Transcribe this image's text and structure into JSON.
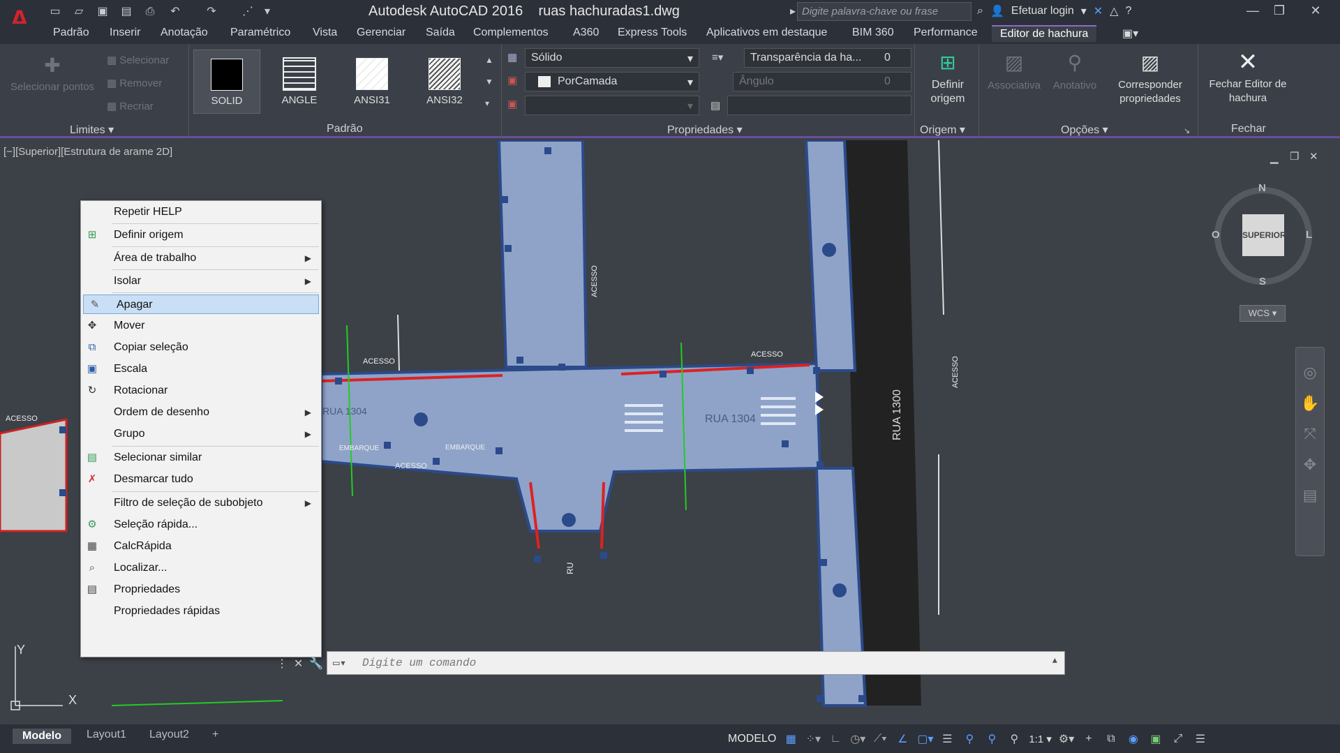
{
  "app": {
    "logo": "A",
    "title": "Autodesk AutoCAD 2016",
    "file": "ruas hachuradas1.dwg"
  },
  "search": {
    "placeholder": "Digite palavra-chave ou frase"
  },
  "account": {
    "login": "Efetuar login"
  },
  "menu_tabs": [
    "Padrão",
    "Inserir",
    "Anotação",
    "Paramétrico",
    "Vista",
    "Gerenciar",
    "Saída",
    "Complementos",
    "A360",
    "Express Tools",
    "Aplicativos em destaque",
    "BIM 360",
    "Performance",
    "Editor de hachura"
  ],
  "ribbon": {
    "limits": {
      "pick": "Selecionar pontos",
      "select": "Selecionar",
      "remove": "Remover",
      "recreate": "Recriar",
      "title": "Limites"
    },
    "patterns": {
      "items": [
        "SOLID",
        "ANGLE",
        "ANSI31",
        "ANSI32"
      ],
      "title": "Padrão"
    },
    "props": {
      "type": "Sólido",
      "color": "PorCamada",
      "transparency_label": "Transparência da ha...",
      "transparency": "0",
      "angle_label": "Ângulo",
      "angle": "0",
      "title": "Propriedades"
    },
    "origin": {
      "set": "Definir origem",
      "title": "Origem"
    },
    "options": {
      "assoc": "Associativa",
      "annot": "Anotativo",
      "match": "Corresponder propriedades",
      "title": "Opções"
    },
    "close": {
      "label": "Fechar Editor de hachura",
      "title": "Fechar"
    }
  },
  "viewport": {
    "label": "[−][Superior][Estrutura de arame 2D]",
    "compass": {
      "n": "N",
      "s": "S",
      "l": "L",
      "o": "O",
      "top": "SUPERIOR"
    },
    "wcs": "WCS"
  },
  "drawing_text": {
    "rua1304": "RUA 1304",
    "rua1304b": "RUA 1304",
    "rua1300": "RUA 1300",
    "acesso": "ACESSO",
    "embarque": "EMBARQUE",
    "ru": "RU"
  },
  "context_menu": [
    "Repetir HELP",
    "Definir origem",
    "Área de trabalho",
    "Isolar",
    "Apagar",
    "Mover",
    "Copiar seleção",
    "Escala",
    "Rotacionar",
    "Ordem de desenho",
    "Grupo",
    "Selecionar similar",
    "Desmarcar tudo",
    "Filtro de seleção de subobjeto",
    "Seleção rápida...",
    "CalcRápida",
    "Localizar...",
    "Propriedades",
    "Propriedades rápidas"
  ],
  "command": {
    "placeholder": "Digite um comando"
  },
  "layout_tabs": [
    "Modelo",
    "Layout1",
    "Layout2"
  ],
  "status": {
    "model": "MODELO",
    "scale": "1:1"
  }
}
